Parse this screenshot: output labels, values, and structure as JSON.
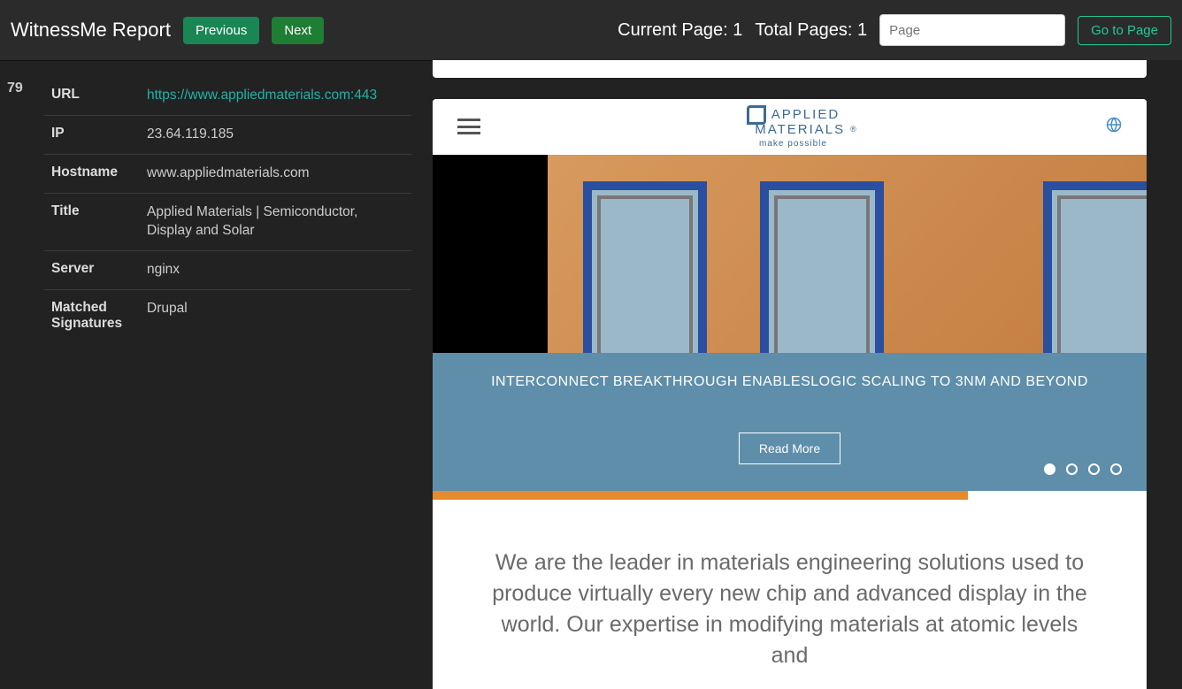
{
  "header": {
    "app_title": "WitnessMe Report",
    "prev_label": "Previous",
    "next_label": "Next",
    "current_page_label": "Current Page: 1",
    "total_pages_label": "Total Pages: 1",
    "page_placeholder": "Page",
    "go_label": "Go to Page"
  },
  "entry": {
    "index": "79",
    "rows": [
      {
        "key": "URL",
        "value": "https://www.appliedmaterials.com:443",
        "link": true
      },
      {
        "key": "IP",
        "value": "23.64.119.185"
      },
      {
        "key": "Hostname",
        "value": "www.appliedmaterials.com"
      },
      {
        "key": "Title",
        "value": "Applied Materials | Semiconductor, Display and Solar"
      },
      {
        "key": "Server",
        "value": "nginx"
      },
      {
        "key": "Matched Signatures",
        "value": "Drupal"
      }
    ]
  },
  "site": {
    "logo_line1": "APPLIED",
    "logo_line2": "MATERIALS",
    "logo_tag": "make possible",
    "banner_title": "INTERCONNECT BREAKTHROUGH ENABLESLOGIC SCALING TO 3NM AND BEYOND",
    "read_more": "Read More",
    "intro": "We are the leader in materials engineering solutions used to produce virtually every new chip and advanced display in the world. Our expertise in modifying materials at atomic levels and"
  }
}
